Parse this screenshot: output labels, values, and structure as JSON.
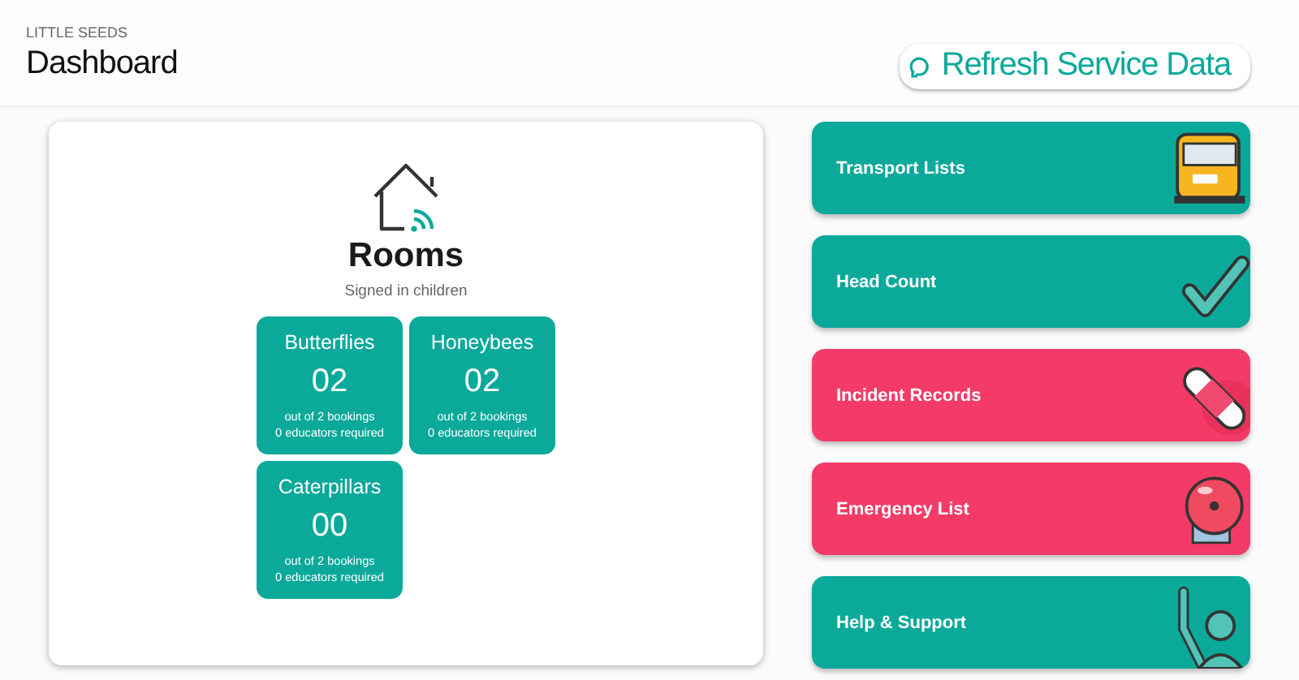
{
  "header": {
    "org": "LITTLE SEEDS",
    "title": "Dashboard",
    "refresh_button": "Refresh Service Data"
  },
  "rooms_panel": {
    "title": "Rooms",
    "subtitle": "Signed in children",
    "rooms": [
      {
        "name": "Butterflies",
        "count": "02",
        "bookings": "out of 2 bookings",
        "educators": "0 educators required"
      },
      {
        "name": "Honeybees",
        "count": "02",
        "bookings": "out of 2 bookings",
        "educators": "0 educators required"
      },
      {
        "name": "Caterpillars",
        "count": "00",
        "bookings": "out of 2 bookings",
        "educators": "0 educators required"
      }
    ]
  },
  "actions": [
    {
      "label": "Transport Lists",
      "color": "#0aa99a",
      "kind": "bus"
    },
    {
      "label": "Head Count",
      "color": "#0aa99a",
      "kind": "check"
    },
    {
      "label": "Incident Records",
      "color": "#f43b68",
      "kind": "bandage"
    },
    {
      "label": "Emergency List",
      "color": "#f43b68",
      "kind": "bell"
    },
    {
      "label": "Help & Support",
      "color": "#0aa99a",
      "kind": "person"
    }
  ]
}
